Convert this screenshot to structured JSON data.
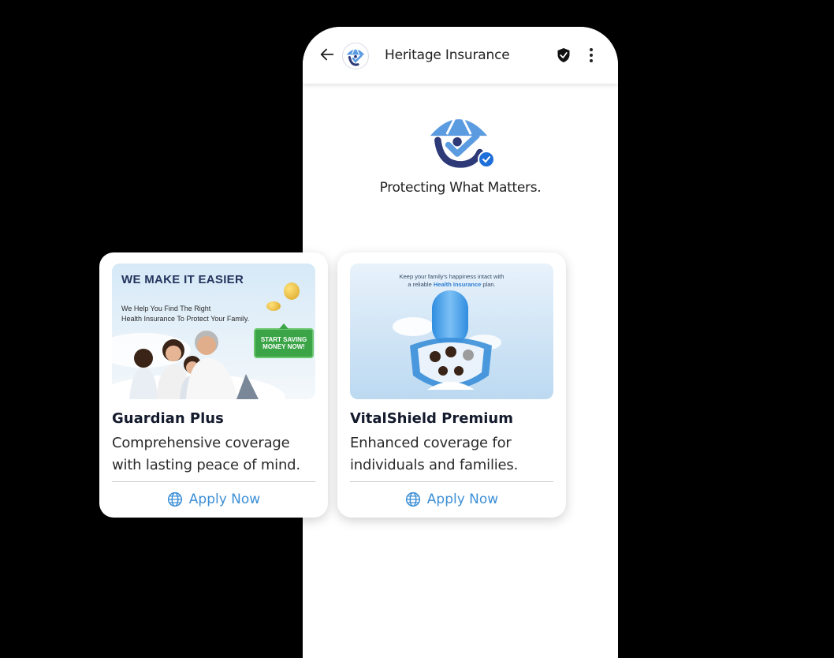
{
  "header": {
    "title": "Heritage Insurance",
    "back_icon": "arrow-left-icon",
    "verified_icon": "shield-check-icon",
    "menu_icon": "more-vertical-icon"
  },
  "profile": {
    "tagline": "Protecting What Matters.",
    "logo": "umbrella-person-logo",
    "verified_badge": "check-icon"
  },
  "cards": [
    {
      "title": "Guardian Plus",
      "description": "Comprehensive coverage with lasting peace of mind.",
      "action_label": "Apply Now",
      "action_icon": "globe-icon",
      "image": {
        "headline": "WE MAKE IT EASIER",
        "line1": "We Help You Find The Right",
        "line2": "Health Insurance To Protect Your Family.",
        "badge_line1": "START SAVING",
        "badge_line2": "MONEY NOW!"
      }
    },
    {
      "title": "VitalShield Premium",
      "description": "Enhanced coverage for individuals and families.",
      "action_label": "Apply Now",
      "action_icon": "globe-icon",
      "image": {
        "line1": "Keep your family's happiness intact with",
        "line2_prefix": "a reliable ",
        "line2_highlight": "Health Insurance",
        "line2_suffix": " plan."
      }
    }
  ],
  "colors": {
    "accent": "#3c8fd6",
    "title_text": "#141b2d",
    "background": "#000000",
    "verified": "#1e6fd9"
  }
}
